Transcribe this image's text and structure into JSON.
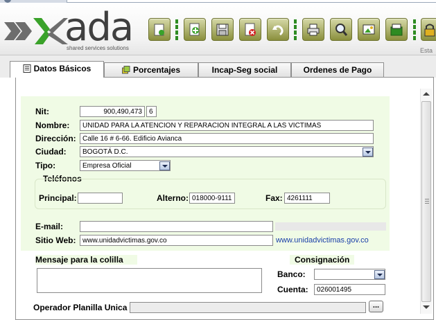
{
  "logo": {
    "word": "ada",
    "tagline": "shared services solutions"
  },
  "toolbar": {
    "buttons": [
      {
        "name": "open-folder"
      },
      {
        "name": "new-document"
      },
      {
        "name": "save"
      },
      {
        "name": "delete"
      },
      {
        "name": "undo"
      },
      {
        "name": "print"
      },
      {
        "name": "search"
      },
      {
        "name": "export-image"
      },
      {
        "name": "export-excel"
      },
      {
        "name": "lock"
      }
    ],
    "overflow_label": "Esta"
  },
  "tabs": [
    {
      "label": "Datos Básicos",
      "active": true
    },
    {
      "label": "Porcentajes",
      "active": false
    },
    {
      "label": "Incap-Seg social",
      "active": false
    },
    {
      "label": "Ordenes de Pago",
      "active": false
    }
  ],
  "form": {
    "nit": {
      "label": "Nit:",
      "value": "900,490,473",
      "check_digit": "6"
    },
    "nombre": {
      "label": "Nombre:",
      "value": "UNIDAD PARA LA ATENCION Y REPARACION INTEGRAL A LAS VICTIMAS"
    },
    "direccion": {
      "label": "Dirección:",
      "value": "Calle 16 # 6-66. Edificio Avianca"
    },
    "ciudad": {
      "label": "Ciudad:",
      "value": "BOGOTÁ D.C."
    },
    "tipo": {
      "label": "Tipo:",
      "value": "Empresa Oficial"
    },
    "telefonos": {
      "legend": "Teléfonos",
      "principal": {
        "label": "Principal:",
        "value": ""
      },
      "alterno": {
        "label": "Alterno:",
        "value": "018000-9111"
      },
      "fax": {
        "label": "Fax:",
        "value": "4261111"
      }
    },
    "email": {
      "label": "E-mail:",
      "value": ""
    },
    "sitio_web": {
      "label": "Sitio Web:",
      "value": "www.unidadvictimas.gov.co",
      "link": "www.unidadvictimas.gov.co"
    },
    "mensaje": {
      "label": "Mensaje para la colilla",
      "value": ""
    },
    "consignacion": {
      "legend": "Consignación",
      "banco": {
        "label": "Banco:",
        "value": ""
      },
      "cuenta": {
        "label": "Cuenta:",
        "value": "026001495"
      }
    },
    "operador": {
      "label": "Operador Planilla Unica",
      "value": "",
      "button_label": "..."
    }
  },
  "colors": {
    "accent_green": "#2e8b22",
    "form_background": "#f0fbe5",
    "link": "#1a3fa8"
  }
}
